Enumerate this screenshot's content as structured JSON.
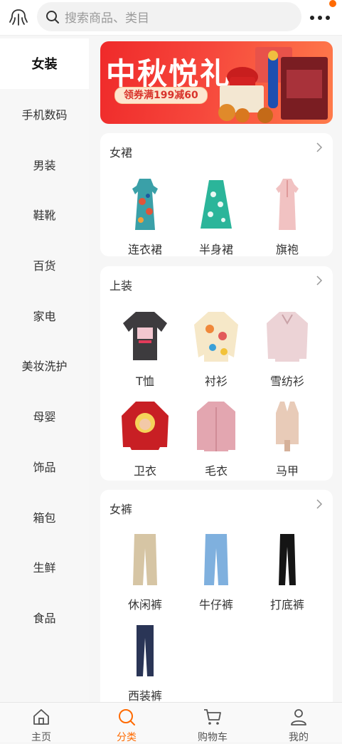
{
  "header": {
    "search_placeholder": "搜索商品、类目"
  },
  "sidebar": {
    "items": [
      {
        "label": "女装",
        "active": true
      },
      {
        "label": "手机数码"
      },
      {
        "label": "男装"
      },
      {
        "label": "鞋靴"
      },
      {
        "label": "百货"
      },
      {
        "label": "家电"
      },
      {
        "label": "美妆洗护"
      },
      {
        "label": "母婴"
      },
      {
        "label": "饰品"
      },
      {
        "label": "箱包"
      },
      {
        "label": "生鲜"
      },
      {
        "label": "食品"
      }
    ]
  },
  "banner": {
    "title": "中秋悦礼",
    "coupon": "领券满199减60"
  },
  "sections": [
    {
      "title": "女裙",
      "items": [
        "连衣裙",
        "半身裙",
        "旗袍"
      ]
    },
    {
      "title": "上装",
      "items": [
        "T恤",
        "衬衫",
        "雪纺衫",
        "卫衣",
        "毛衣",
        "马甲"
      ]
    },
    {
      "title": "女裤",
      "items": [
        "休闲裤",
        "牛仔裤",
        "打底裤",
        "西装裤"
      ]
    }
  ],
  "tabbar": {
    "items": [
      {
        "label": "主页",
        "icon": "home-icon"
      },
      {
        "label": "分类",
        "icon": "category-icon",
        "active": true
      },
      {
        "label": "购物车",
        "icon": "cart-icon"
      },
      {
        "label": "我的",
        "icon": "profile-icon"
      }
    ]
  },
  "colors": {
    "accent": "#ff6a00",
    "banner": "#ef2a2a"
  }
}
